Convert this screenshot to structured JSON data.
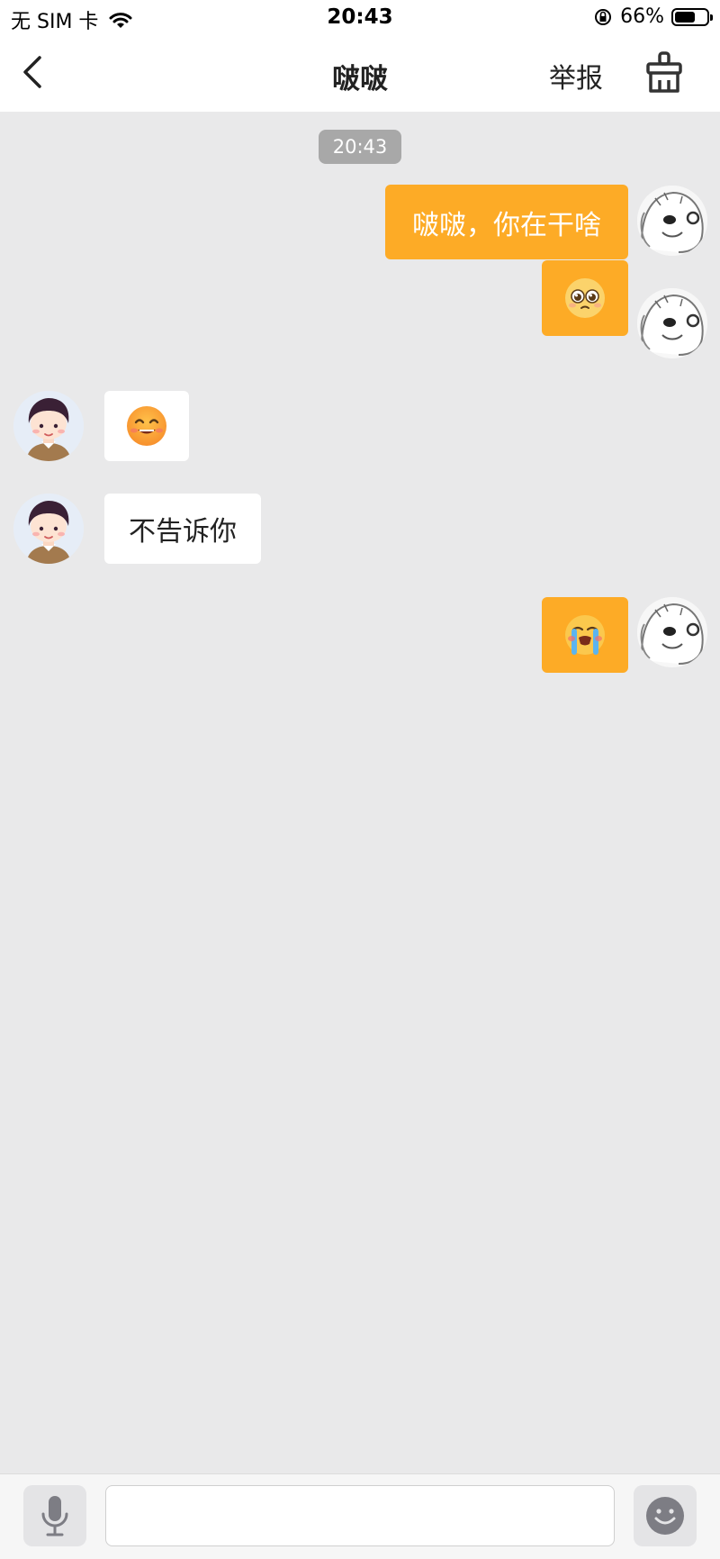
{
  "status_bar": {
    "carrier": "无 SIM 卡",
    "time": "20:43",
    "battery_percent": "66%",
    "battery_level": 0.66,
    "icons": [
      "wifi-icon",
      "orientation-lock-icon",
      "battery-icon"
    ]
  },
  "nav": {
    "title": "啵啵",
    "report_label": "举报",
    "icons": [
      "back-icon",
      "clean-brush-icon"
    ]
  },
  "chat": {
    "timestamp": "20:43",
    "messages": [
      {
        "side": "me",
        "type": "text",
        "text": "啵啵，你在干啥"
      },
      {
        "side": "me",
        "type": "emoji",
        "emoji": "pleading-face"
      },
      {
        "side": "other",
        "type": "emoji",
        "emoji": "grinning-face"
      },
      {
        "side": "other",
        "type": "text",
        "text": "不告诉你"
      },
      {
        "side": "me",
        "type": "emoji",
        "emoji": "crying-face"
      }
    ]
  },
  "colors": {
    "outgoing_bubble": "#fdab26",
    "incoming_bubble": "#ffffff",
    "chat_background": "#e9e9ea",
    "timestamp_pill": "#a8a8a8"
  },
  "input_bar": {
    "input_value": "",
    "icons": [
      "microphone-icon",
      "smiley-icon"
    ]
  }
}
